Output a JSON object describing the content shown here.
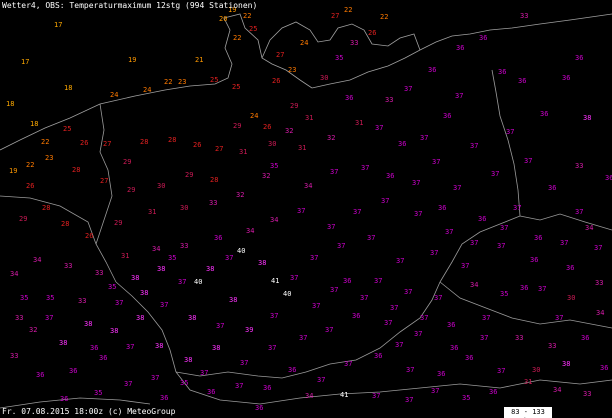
{
  "title": "Wetter4, OBS: Temperaturmaximum 12stg (994 Stationen)",
  "footer": "Fr. 07.08.2015 18:00z (c) MeteoGroup",
  "scale_label": "83 - 133 km",
  "colors": {
    "c17": "#ffaa00",
    "c21": "#ff9900",
    "c24": "#ff7a00",
    "c27": "#e22020",
    "c30": "#cc1a55",
    "c33": "#d61aa8",
    "c35": "#cc00cc",
    "c38": "#ff33ff",
    "c40": "#ffffff",
    "border": "#9a9a9a",
    "coast": "#a0a0a0"
  },
  "icons": {
    "scale": "scale-bar-icon"
  },
  "stations": {
    "labeled": [
      [
        "17",
        54,
        27
      ],
      [
        "17",
        21,
        64
      ],
      [
        "19",
        128,
        62
      ],
      [
        "18",
        64,
        90
      ],
      [
        "18",
        6,
        106
      ],
      [
        "18",
        30,
        126
      ],
      [
        "19",
        9,
        173
      ],
      [
        "21",
        195,
        62
      ],
      [
        "20",
        219,
        21
      ],
      [
        "19",
        228,
        12
      ],
      [
        "22",
        243,
        18
      ],
      [
        "25",
        249,
        31
      ],
      [
        "22",
        233,
        40
      ],
      [
        "27",
        276,
        57
      ],
      [
        "23",
        288,
        72
      ],
      [
        "25",
        232,
        89
      ],
      [
        "24",
        250,
        118
      ],
      [
        "29",
        233,
        128
      ],
      [
        "26",
        263,
        129
      ],
      [
        "24",
        110,
        97
      ],
      [
        "22",
        164,
        84
      ],
      [
        "23",
        178,
        84
      ],
      [
        "24",
        143,
        92
      ],
      [
        "25",
        210,
        82
      ],
      [
        "26",
        272,
        83
      ],
      [
        "27",
        331,
        18
      ],
      [
        "22",
        344,
        12
      ],
      [
        "22",
        380,
        19
      ],
      [
        "26",
        368,
        35
      ],
      [
        "24",
        300,
        45
      ],
      [
        "29",
        290,
        108
      ],
      [
        "25",
        63,
        131
      ],
      [
        "26",
        80,
        145
      ],
      [
        "22",
        41,
        144
      ],
      [
        "22",
        26,
        167
      ],
      [
        "23",
        45,
        160
      ],
      [
        "26",
        26,
        188
      ],
      [
        "27",
        103,
        146
      ],
      [
        "29",
        123,
        164
      ],
      [
        "28",
        140,
        144
      ],
      [
        "28",
        168,
        142
      ],
      [
        "26",
        193,
        147
      ],
      [
        "27",
        215,
        151
      ],
      [
        "28",
        72,
        172
      ],
      [
        "27",
        100,
        183
      ],
      [
        "29",
        127,
        192
      ],
      [
        "30",
        157,
        188
      ],
      [
        "29",
        185,
        177
      ],
      [
        "28",
        210,
        182
      ],
      [
        "28",
        42,
        210
      ],
      [
        "29",
        19,
        221
      ],
      [
        "28",
        61,
        226
      ],
      [
        "26",
        85,
        238
      ],
      [
        "29",
        114,
        225
      ],
      [
        "31",
        148,
        214
      ],
      [
        "30",
        180,
        210
      ],
      [
        "31",
        239,
        154
      ],
      [
        "30",
        268,
        146
      ],
      [
        "31",
        298,
        150
      ],
      [
        "32",
        327,
        140
      ],
      [
        "31",
        355,
        125
      ],
      [
        "33",
        385,
        102
      ],
      [
        "37",
        404,
        91
      ],
      [
        "36",
        428,
        72
      ],
      [
        "36",
        456,
        50
      ],
      [
        "36",
        479,
        40
      ],
      [
        "36",
        518,
        83
      ],
      [
        "36",
        562,
        80
      ],
      [
        "36",
        540,
        116
      ],
      [
        "37",
        506,
        134
      ],
      [
        "36",
        443,
        118
      ],
      [
        "37",
        470,
        148
      ],
      [
        "37",
        432,
        164
      ],
      [
        "36",
        398,
        146
      ],
      [
        "37",
        361,
        170
      ],
      [
        "37",
        330,
        174
      ],
      [
        "34",
        304,
        188
      ],
      [
        "32",
        262,
        178
      ],
      [
        "32",
        236,
        197
      ],
      [
        "33",
        209,
        205
      ],
      [
        "37",
        453,
        190
      ],
      [
        "37",
        491,
        176
      ],
      [
        "37",
        524,
        163
      ],
      [
        "33",
        575,
        168
      ],
      [
        "36",
        548,
        190
      ],
      [
        "37",
        513,
        210
      ],
      [
        "36",
        478,
        221
      ],
      [
        "37",
        445,
        234
      ],
      [
        "37",
        414,
        216
      ],
      [
        "37",
        381,
        203
      ],
      [
        "37",
        353,
        214
      ],
      [
        "37",
        327,
        229
      ],
      [
        "37",
        297,
        213
      ],
      [
        "34",
        270,
        222
      ],
      [
        "34",
        246,
        233
      ],
      [
        "36",
        214,
        240
      ],
      [
        "33",
        180,
        248
      ],
      [
        "34",
        152,
        251
      ],
      [
        "31",
        121,
        258
      ],
      [
        "33",
        95,
        275
      ],
      [
        "33",
        64,
        268
      ],
      [
        "34",
        33,
        262
      ],
      [
        "34",
        10,
        276
      ],
      [
        "35",
        46,
        300
      ],
      [
        "33",
        78,
        303
      ],
      [
        "35",
        108,
        289
      ],
      [
        "38",
        131,
        280
      ],
      [
        "38",
        157,
        271
      ],
      [
        "37",
        178,
        284
      ],
      [
        "38",
        206,
        271
      ],
      [
        "40",
        237,
        253
      ],
      [
        "40",
        194,
        284
      ],
      [
        "38",
        229,
        302
      ],
      [
        "41",
        271,
        283
      ],
      [
        "40",
        283,
        296
      ],
      [
        "37",
        310,
        260
      ],
      [
        "37",
        337,
        248
      ],
      [
        "37",
        367,
        240
      ],
      [
        "37",
        396,
        263
      ],
      [
        "37",
        430,
        255
      ],
      [
        "37",
        461,
        268
      ],
      [
        "37",
        497,
        248
      ],
      [
        "36",
        534,
        240
      ],
      [
        "37",
        575,
        214
      ],
      [
        "37",
        594,
        250
      ],
      [
        "36",
        566,
        270
      ],
      [
        "37",
        538,
        291
      ],
      [
        "35",
        500,
        296
      ],
      [
        "34",
        470,
        287
      ],
      [
        "37",
        434,
        300
      ],
      [
        "37",
        404,
        294
      ],
      [
        "37",
        374,
        283
      ],
      [
        "36",
        343,
        283
      ],
      [
        "37",
        312,
        308
      ],
      [
        "37",
        270,
        318
      ],
      [
        "39",
        245,
        332
      ],
      [
        "37",
        216,
        328
      ],
      [
        "38",
        188,
        320
      ],
      [
        "37",
        160,
        307
      ],
      [
        "38",
        136,
        320
      ],
      [
        "38",
        110,
        333
      ],
      [
        "38",
        84,
        326
      ],
      [
        "32",
        29,
        332
      ],
      [
        "38",
        59,
        345
      ],
      [
        "33",
        10,
        358
      ],
      [
        "36",
        36,
        377
      ],
      [
        "36",
        69,
        373
      ],
      [
        "36",
        99,
        360
      ],
      [
        "37",
        126,
        349
      ],
      [
        "38",
        155,
        348
      ],
      [
        "38",
        184,
        362
      ],
      [
        "38",
        212,
        350
      ],
      [
        "37",
        240,
        365
      ],
      [
        "37",
        268,
        350
      ],
      [
        "37",
        299,
        340
      ],
      [
        "37",
        325,
        332
      ],
      [
        "36",
        352,
        318
      ],
      [
        "37",
        384,
        325
      ],
      [
        "37",
        414,
        336
      ],
      [
        "36",
        447,
        327
      ],
      [
        "37",
        482,
        320
      ],
      [
        "33",
        515,
        340
      ],
      [
        "33",
        548,
        348
      ],
      [
        "36",
        581,
        340
      ],
      [
        "38",
        562,
        366
      ],
      [
        "30",
        532,
        372
      ],
      [
        "37",
        497,
        373
      ],
      [
        "36",
        465,
        360
      ],
      [
        "36",
        437,
        376
      ],
      [
        "37",
        406,
        372
      ],
      [
        "36",
        374,
        358
      ],
      [
        "37",
        344,
        366
      ],
      [
        "37",
        317,
        382
      ],
      [
        "36",
        288,
        372
      ],
      [
        "36",
        263,
        390
      ],
      [
        "37",
        235,
        388
      ],
      [
        "36",
        207,
        394
      ],
      [
        "35",
        180,
        385
      ],
      [
        "37",
        151,
        380
      ],
      [
        "37",
        124,
        386
      ],
      [
        "35",
        94,
        395
      ],
      [
        "36",
        60,
        401
      ],
      [
        "33",
        583,
        396
      ],
      [
        "34",
        553,
        392
      ],
      [
        "31",
        524,
        384
      ],
      [
        "36",
        489,
        394
      ],
      [
        "35",
        462,
        400
      ],
      [
        "37",
        431,
        393
      ],
      [
        "41",
        340,
        397
      ],
      [
        "37",
        372,
        398
      ],
      [
        "37",
        405,
        402
      ],
      [
        "34",
        305,
        398
      ],
      [
        "37",
        395,
        347
      ],
      [
        "36",
        520,
        290
      ],
      [
        "30",
        567,
        300
      ],
      [
        "34",
        596,
        315
      ],
      [
        "34",
        585,
        230
      ],
      [
        "36",
        605,
        180
      ],
      [
        "38",
        583,
        120
      ],
      [
        "36",
        575,
        60
      ],
      [
        "33",
        520,
        18
      ],
      [
        "36",
        498,
        74
      ],
      [
        "37",
        455,
        98
      ],
      [
        "37",
        420,
        140
      ],
      [
        "37",
        375,
        130
      ],
      [
        "36",
        345,
        100
      ],
      [
        "30",
        320,
        80
      ],
      [
        "35",
        335,
        60
      ],
      [
        "33",
        350,
        45
      ],
      [
        "31",
        305,
        120
      ],
      [
        "32",
        285,
        133
      ],
      [
        "35",
        270,
        168
      ],
      [
        "36",
        386,
        178
      ],
      [
        "37",
        412,
        185
      ],
      [
        "36",
        438,
        210
      ],
      [
        "37",
        470,
        245
      ],
      [
        "37",
        500,
        230
      ],
      [
        "36",
        530,
        262
      ],
      [
        "37",
        560,
        245
      ],
      [
        "37",
        555,
        320
      ],
      [
        "36",
        600,
        370
      ],
      [
        "33",
        595,
        285
      ],
      [
        "37",
        480,
        340
      ],
      [
        "36",
        450,
        350
      ],
      [
        "37",
        420,
        320
      ],
      [
        "37",
        390,
        310
      ],
      [
        "37",
        360,
        300
      ],
      [
        "37",
        330,
        292
      ],
      [
        "37",
        290,
        280
      ],
      [
        "38",
        258,
        265
      ],
      [
        "37",
        225,
        260
      ],
      [
        "35",
        168,
        260
      ],
      [
        "38",
        140,
        295
      ],
      [
        "37",
        115,
        305
      ],
      [
        "36",
        90,
        350
      ],
      [
        "35",
        20,
        300
      ],
      [
        "33",
        15,
        320
      ],
      [
        "37",
        45,
        320
      ],
      [
        "36",
        160,
        400
      ],
      [
        "37",
        200,
        375
      ],
      [
        "36",
        255,
        410
      ]
    ]
  }
}
